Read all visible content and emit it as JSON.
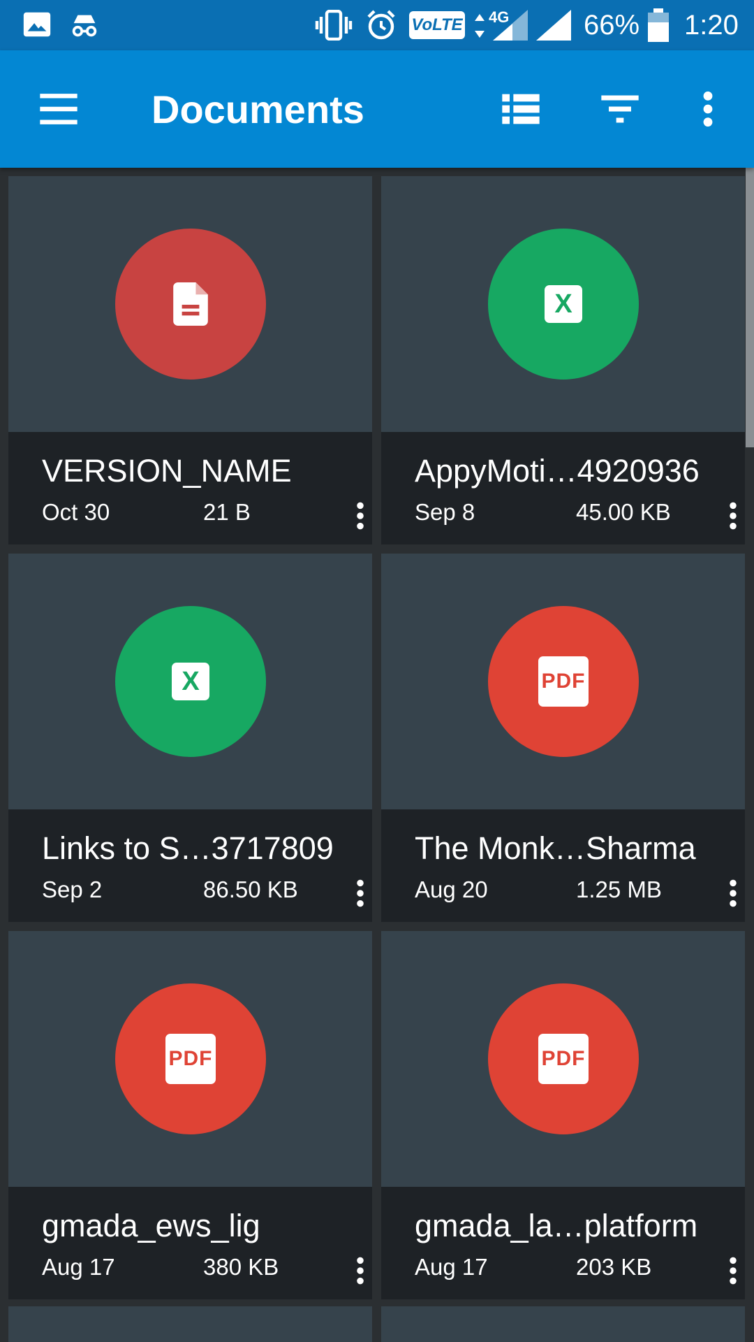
{
  "status_bar": {
    "icons": [
      "gallery-icon",
      "incognito-icon",
      "vibrate-icon",
      "alarm-icon",
      "volte-icon",
      "data-arrows-icon",
      "signal-4g-icon",
      "signal-icon",
      "battery-icon"
    ],
    "volte_label": "VoLTE",
    "network_label": "4G",
    "battery_percent": "66%",
    "time": "1:20"
  },
  "app_bar": {
    "title": "Documents",
    "icons": [
      "menu-icon",
      "list-view-icon",
      "filter-icon",
      "more-vert-icon"
    ]
  },
  "colors": {
    "status_bar": "#0a6fb3",
    "app_bar": "#0387d3",
    "card_thumb": "#36434c",
    "card_info": "#1e2226",
    "doc_red": "#c84341",
    "excel_green": "#17a862",
    "pdf_red": "#df4335"
  },
  "files": [
    {
      "name": "VERSION_NAME",
      "date": "Oct 30",
      "size": "21 B",
      "type": "doc"
    },
    {
      "name": "AppyMoti…4920936",
      "date": "Sep 8",
      "size": "45.00 KB",
      "type": "xls",
      "badge": "X"
    },
    {
      "name": "Links to S…3717809",
      "date": "Sep 2",
      "size": "86.50 KB",
      "type": "xls",
      "badge": "X"
    },
    {
      "name": "The Monk…Sharma",
      "date": "Aug 20",
      "size": "1.25 MB",
      "type": "pdf",
      "badge": "PDF"
    },
    {
      "name": "gmada_ews_lig",
      "date": "Aug 17",
      "size": "380 KB",
      "type": "pdf",
      "badge": "PDF"
    },
    {
      "name": "gmada_la…platform",
      "date": "Aug 17",
      "size": "203 KB",
      "type": "pdf",
      "badge": "PDF"
    }
  ]
}
